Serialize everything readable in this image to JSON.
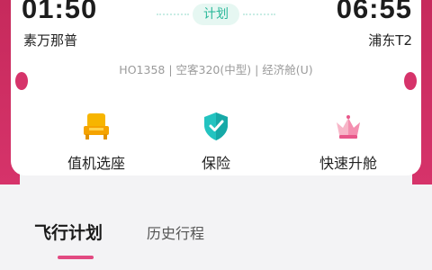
{
  "flight": {
    "status": "计划",
    "departure": {
      "time": "01:50",
      "airport": "素万那普"
    },
    "arrival": {
      "time": "06:55",
      "airport": "浦东T2"
    },
    "info": "HO1358 | 空客320(中型) | 经济舱(U)"
  },
  "services": [
    {
      "label": "值机选座",
      "icon": "check-in-seat-icon"
    },
    {
      "label": "保险",
      "icon": "insurance-shield-icon"
    },
    {
      "label": "快速升舱",
      "icon": "upgrade-crown-icon"
    }
  ],
  "tabs": {
    "plan_label": "飞行计划",
    "history_label": "历史行程"
  },
  "colors": {
    "brand": "#d6336a",
    "status_green": "#2bb89a",
    "tab_indicator": "#e24a82"
  }
}
